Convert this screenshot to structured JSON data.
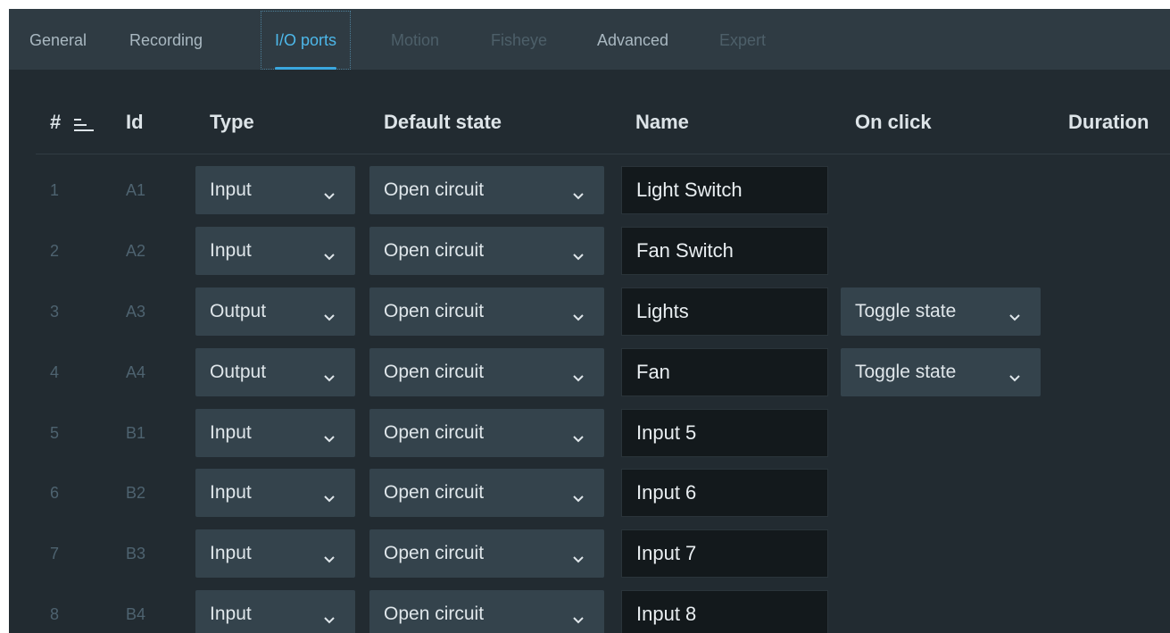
{
  "tabs": [
    {
      "label": "General",
      "state": "normal"
    },
    {
      "label": "Recording",
      "state": "normal"
    },
    {
      "label": "I/O ports",
      "state": "active"
    },
    {
      "label": "Motion",
      "state": "disabled"
    },
    {
      "label": "Fisheye",
      "state": "disabled"
    },
    {
      "label": "Advanced",
      "state": "normal"
    },
    {
      "label": "Expert",
      "state": "disabled"
    }
  ],
  "table": {
    "headers": {
      "num": "#",
      "id": "Id",
      "type": "Type",
      "default_state": "Default state",
      "name": "Name",
      "on_click": "On click",
      "duration": "Duration"
    },
    "sort_icon": "sort-ascending-icon",
    "rows": [
      {
        "num": "1",
        "id": "A1",
        "type": "Input",
        "default_state": "Open circuit",
        "name": "Light Switch",
        "on_click": ""
      },
      {
        "num": "2",
        "id": "A2",
        "type": "Input",
        "default_state": "Open circuit",
        "name": "Fan Switch",
        "on_click": ""
      },
      {
        "num": "3",
        "id": "A3",
        "type": "Output",
        "default_state": "Open circuit",
        "name": "Lights",
        "on_click": "Toggle state"
      },
      {
        "num": "4",
        "id": "A4",
        "type": "Output",
        "default_state": "Open circuit",
        "name": "Fan",
        "on_click": "Toggle state"
      },
      {
        "num": "5",
        "id": "B1",
        "type": "Input",
        "default_state": "Open circuit",
        "name": "Input 5",
        "on_click": ""
      },
      {
        "num": "6",
        "id": "B2",
        "type": "Input",
        "default_state": "Open circuit",
        "name": "Input 6",
        "on_click": ""
      },
      {
        "num": "7",
        "id": "B3",
        "type": "Input",
        "default_state": "Open circuit",
        "name": "Input 7",
        "on_click": ""
      },
      {
        "num": "8",
        "id": "B4",
        "type": "Input",
        "default_state": "Open circuit",
        "name": "Input 8",
        "on_click": ""
      }
    ]
  },
  "colors": {
    "background": "#222b31",
    "tab_bar": "#2f3b43",
    "accent": "#3aa7df",
    "combo": "#34434c",
    "input": "#13191c"
  }
}
